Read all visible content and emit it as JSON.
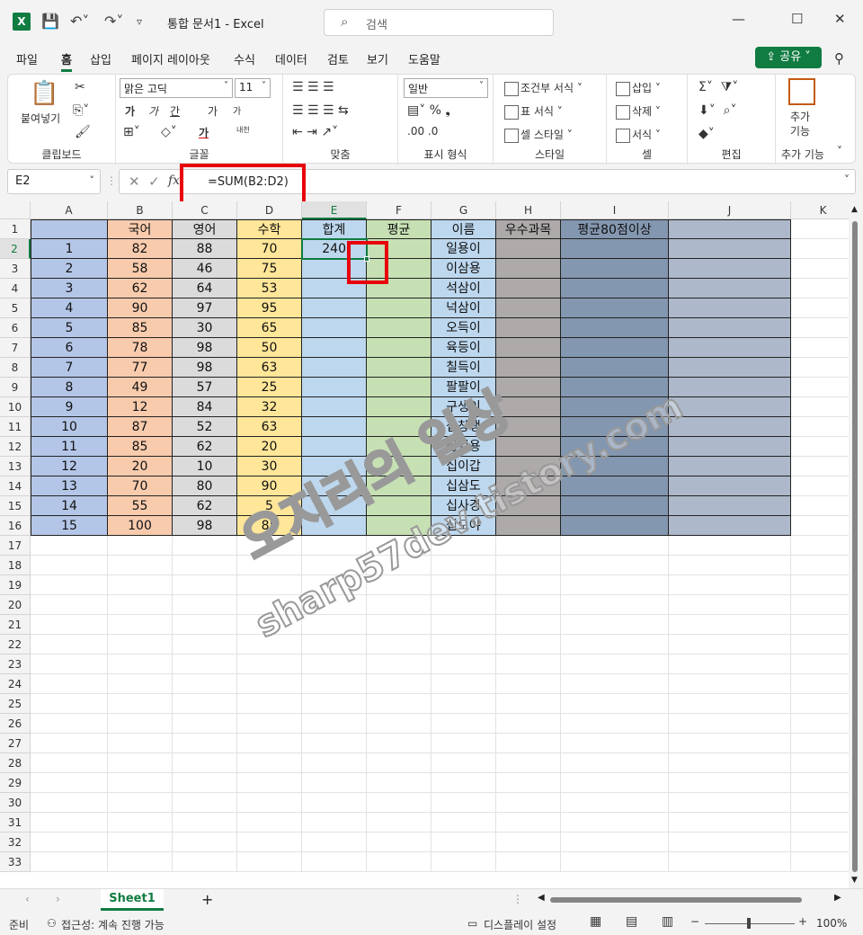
{
  "window": {
    "doc_title": "통합 문서1  -  Excel",
    "search_placeholder": "검색"
  },
  "menu": [
    "파일",
    "홈",
    "삽입",
    "페이지 레이아웃",
    "수식",
    "데이터",
    "검토",
    "보기",
    "도움말"
  ],
  "menu_active": "홈",
  "share_label": "공유",
  "ribbon": {
    "clipboard": {
      "paste": "붙여넣기",
      "label": "클립보드"
    },
    "font": {
      "name": "맑은 고딕",
      "size": "11",
      "label": "글꼴",
      "bold": "가",
      "italic": "가",
      "underline": "간",
      "grow": "가",
      "shrink": "가",
      "color_letter": "가",
      "phonetic": "내천"
    },
    "align": {
      "label": "맞춤"
    },
    "number": {
      "format": "일반",
      "label": "표시 형식"
    },
    "styles": {
      "cond": "조건부 서식",
      "table": "표 서식",
      "cell": "셀 스타일",
      "label": "스타일"
    },
    "cells": {
      "insert": "삽입",
      "delete": "삭제",
      "format": "서식",
      "label": "셀"
    },
    "edit": {
      "label": "편집"
    },
    "addins": {
      "btn1": "추가",
      "btn2": "기능",
      "label": "추가 기능"
    }
  },
  "formula_bar": {
    "name_box": "E2",
    "fx": "fx",
    "formula": "=SUM(B2:D2)"
  },
  "columns": [
    "A",
    "B",
    "C",
    "D",
    "E",
    "F",
    "G",
    "H",
    "I",
    "J",
    "K"
  ],
  "header_row": [
    "",
    "국어",
    "영어",
    "수학",
    "합계",
    "평균",
    "이름",
    "우수과목",
    "평균80점이상",
    ""
  ],
  "rows": [
    [
      "1",
      "82",
      "88",
      "70",
      "240",
      "",
      "일용이"
    ],
    [
      "2",
      "58",
      "46",
      "75",
      "",
      "",
      "이삼용"
    ],
    [
      "3",
      "62",
      "64",
      "53",
      "",
      "",
      "석삼이"
    ],
    [
      "4",
      "90",
      "97",
      "95",
      "",
      "",
      "넉삼이"
    ],
    [
      "5",
      "85",
      "30",
      "65",
      "",
      "",
      "오득이"
    ],
    [
      "6",
      "78",
      "98",
      "50",
      "",
      "",
      "육등이"
    ],
    [
      "7",
      "77",
      "98",
      "63",
      "",
      "",
      "칠득이"
    ],
    [
      "8",
      "49",
      "57",
      "25",
      "",
      "",
      "팔팔이"
    ],
    [
      "9",
      "12",
      "84",
      "32",
      "",
      "",
      "구생이"
    ],
    [
      "10",
      "87",
      "52",
      "63",
      "",
      "",
      "십창생"
    ],
    [
      "11",
      "85",
      "62",
      "20",
      "",
      "",
      "십일용"
    ],
    [
      "12",
      "20",
      "10",
      "30",
      "",
      "",
      "십이갑"
    ],
    [
      "13",
      "70",
      "80",
      "90",
      "",
      "",
      "십삼도"
    ],
    [
      "14",
      "55",
      "62",
      "5",
      "",
      "",
      "십사경"
    ],
    [
      "15",
      "100",
      "98",
      "85",
      "",
      "",
      "십오야"
    ]
  ],
  "row_numbers": [
    "1",
    "2",
    "3",
    "4",
    "5",
    "6",
    "7",
    "8",
    "9",
    "10",
    "11",
    "12",
    "13",
    "14",
    "15",
    "16",
    "17",
    "18",
    "19",
    "20",
    "21",
    "22",
    "23",
    "24",
    "25",
    "26",
    "27",
    "28",
    "29",
    "30",
    "31",
    "32",
    "33"
  ],
  "colors": {
    "col_a": "#b4c6e7",
    "col_b": "#f8cbad",
    "col_c": "#dbdbdb",
    "col_d": "#ffe699",
    "col_e": "#bdd7ee",
    "col_f": "#c6e0b4",
    "col_g": "#bdd7ee",
    "col_h": "#aeaaaa",
    "col_i": "#8497b0",
    "col_j": "#adb9ca",
    "accent": "#107c41",
    "red": "#e8000b"
  },
  "watermark": {
    "line1": "오지리의 일상",
    "line2": "sharp57dev.tistory.com"
  },
  "sheet_tab": "Sheet1",
  "status": {
    "ready": "준비",
    "accessibility": "접근성: 계속 진행 가능",
    "display": "디스플레이 설정",
    "zoom": "100%"
  }
}
